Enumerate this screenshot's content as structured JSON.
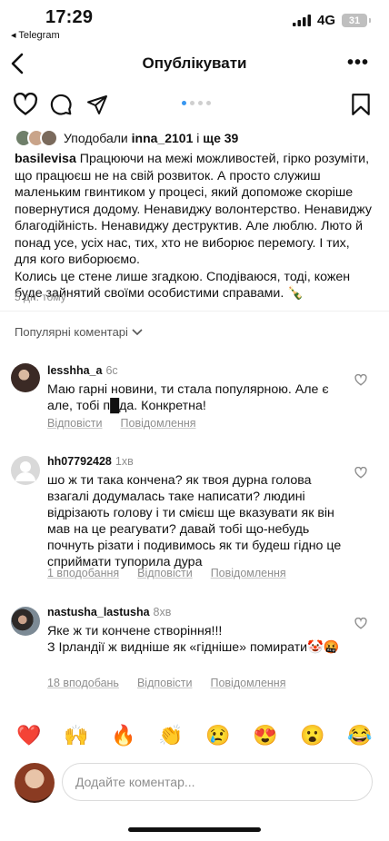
{
  "status_bar": {
    "time": "17:29",
    "back_app": "◂ Telegram",
    "network": "4G",
    "battery": "31"
  },
  "nav": {
    "title": "Опублікувати",
    "more": "•••"
  },
  "post": {
    "liked_by_prefix": "Уподобали",
    "liked_by_user": "inna_2101",
    "liked_by_and": "і",
    "liked_by_more": "ще 39",
    "author": "basilevisa",
    "caption": "Працюючи на межі можливостей, гірко розуміти, що працюєш не на свій розвиток. А просто служиш маленьким гвинтиком у процесі, який допоможе скоріше повернутися додому. Ненавиджу волонтерство. Ненавиджу благодійність. Ненавиджу деструктив. Але люблю. Лютo й понад усе, усіх нас, тих, хто не виборює перемогу. І тих, для кого виборюємо.",
    "caption_2": "Колись це стене лише згадкою. Сподіваюся, тоді, кожен буде зайнятий своїми особистими справами. 🍾",
    "time_ago": "5 дн. тому"
  },
  "comments_header": "Популярні коментарі",
  "comments": [
    {
      "user": "lesshha_a",
      "time": "6с",
      "text": "Маю гарні новини, ти стала популярною. Але є але, тобі п█да. Конкретна!",
      "likes": "",
      "reply": "Відповісти",
      "hide": "Повідомлення"
    },
    {
      "user": "hh07792428",
      "time": "1хв",
      "text": "шо ж ти така кончена? як твоя дурна голова взагалі додумалась таке написати? людині відрізають голову і ти смієш ще вказувати як він мав на це реагувати? давай тобі що-небудь почнуть різати і подивимось як ти будеш гідно це сприймати тупорила дура",
      "likes": "1 вподобання",
      "reply": "Відповісти",
      "hide": "Повідомлення"
    },
    {
      "user": "nastusha_lastusha",
      "time": "8хв",
      "text": "Яке ж ти кончене створіння!!!",
      "text_2": "З Ірландії ж видніше як «гідніше» помирати🤡🤬",
      "likes": "18 вподобань",
      "reply": "Відповісти",
      "hide": "Повідомлення"
    }
  ],
  "emoji_bar": [
    "❤️",
    "🙌",
    "🔥",
    "👏",
    "😢",
    "😍",
    "😮",
    "😂"
  ],
  "composer": {
    "placeholder": "Додайте коментар..."
  }
}
